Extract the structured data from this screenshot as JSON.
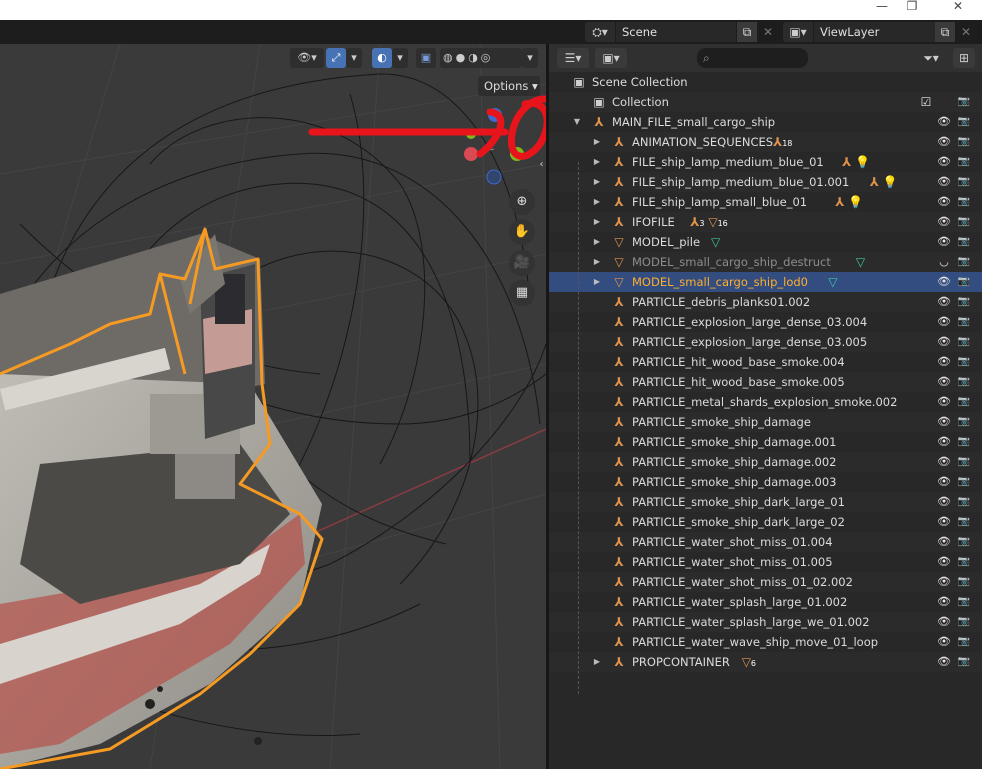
{
  "window": {
    "controls": [
      "—",
      "❐",
      "✕"
    ]
  },
  "scene_selector": {
    "icon": "scene-icon",
    "value": "Scene"
  },
  "viewlayer_selector": {
    "icon": "viewlayer-icon",
    "value": "ViewLayer"
  },
  "viewport": {
    "options_label": "Options",
    "overlay_annotation_color": "#e8141c",
    "selection_outline_color": "#f59a23"
  },
  "outliner": {
    "search_placeholder": "",
    "rows": [
      {
        "name": "Scene Collection",
        "type": "scene-collection"
      },
      {
        "name": "Collection",
        "type": "collection"
      },
      {
        "name": "MAIN_FILE_small_cargo_ship",
        "type": "empty"
      },
      {
        "name": "ANIMATION_SEQUENCES",
        "type": "empty",
        "badge": "18"
      },
      {
        "name": "FILE_ship_lamp_medium_blue_01",
        "type": "empty"
      },
      {
        "name": "FILE_ship_lamp_medium_blue_01.001",
        "type": "empty"
      },
      {
        "name": "FILE_ship_lamp_small_blue_01",
        "type": "empty"
      },
      {
        "name": "IFOFILE",
        "type": "empty",
        "badge": "3",
        "badge2": "16"
      },
      {
        "name": "MODEL_pile",
        "type": "mesh"
      },
      {
        "name": "MODEL_small_cargo_ship_destruct",
        "type": "mesh"
      },
      {
        "name": "MODEL_small_cargo_ship_lod0",
        "type": "mesh"
      },
      {
        "name": "PARTICLE_debris_planks01.002",
        "type": "empty"
      },
      {
        "name": "PARTICLE_explosion_large_dense_03.004",
        "type": "empty"
      },
      {
        "name": "PARTICLE_explosion_large_dense_03.005",
        "type": "empty"
      },
      {
        "name": "PARTICLE_hit_wood_base_smoke.004",
        "type": "empty"
      },
      {
        "name": "PARTICLE_hit_wood_base_smoke.005",
        "type": "empty"
      },
      {
        "name": "PARTICLE_metal_shards_explosion_smoke.002",
        "type": "empty"
      },
      {
        "name": "PARTICLE_smoke_ship_damage",
        "type": "empty"
      },
      {
        "name": "PARTICLE_smoke_ship_damage.001",
        "type": "empty"
      },
      {
        "name": "PARTICLE_smoke_ship_damage.002",
        "type": "empty"
      },
      {
        "name": "PARTICLE_smoke_ship_damage.003",
        "type": "empty"
      },
      {
        "name": "PARTICLE_smoke_ship_dark_large_01",
        "type": "empty"
      },
      {
        "name": "PARTICLE_smoke_ship_dark_large_02",
        "type": "empty"
      },
      {
        "name": "PARTICLE_water_shot_miss_01.004",
        "type": "empty"
      },
      {
        "name": "PARTICLE_water_shot_miss_01.005",
        "type": "empty"
      },
      {
        "name": "PARTICLE_water_shot_miss_01_02.002",
        "type": "empty"
      },
      {
        "name": "PARTICLE_water_splash_large_01.002",
        "type": "empty"
      },
      {
        "name": "PARTICLE_water_splash_large_we_01.002",
        "type": "empty"
      },
      {
        "name": "PARTICLE_water_wave_ship_move_01_loop",
        "type": "empty"
      },
      {
        "name": "PROPCONTAINER",
        "type": "empty",
        "badge": "6"
      }
    ]
  },
  "colors": {
    "empty_icon": "#e0934a",
    "light_icon": "#e0934a",
    "mesh_data_icon": "#3fc5a3",
    "selected_text": "#ffaf29",
    "selected_row": "#334d80"
  }
}
